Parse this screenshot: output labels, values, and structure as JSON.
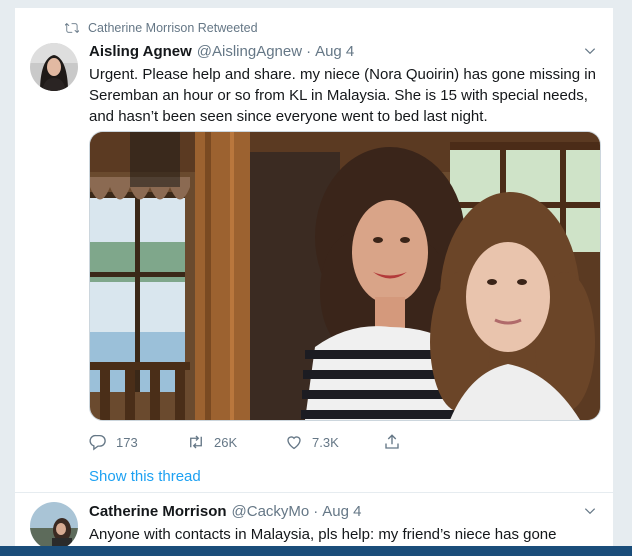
{
  "timeline": {
    "tweet1": {
      "retweet_context": "Catherine Morrison Retweeted",
      "author_name": "Aisling Agnew",
      "author_handle": "@AislingAgnew",
      "separator": "·",
      "date": "Aug 4",
      "text": "Urgent. Please help and share. my niece (Nora Quoirin) has gone missing in Seremban an hour or so from KL in Malaysia. She is 15 with special needs, and hasn’t been seen since everyone went to bed last night.",
      "actions": {
        "replies": "173",
        "retweets": "26K",
        "likes": "7.3K"
      },
      "show_thread": "Show this thread"
    },
    "tweet2": {
      "author_name": "Catherine Morrison",
      "author_handle": "@CackyMo",
      "separator": "·",
      "date": "Aug 4",
      "text": "Anyone with contacts in Malaysia, pls help: my friend’s niece has gone"
    }
  },
  "icons": {
    "retweet_context": "retweet-icon",
    "caret": "chevron-down-icon",
    "reply": "reply-icon",
    "retweet": "retweet-icon",
    "like": "heart-icon",
    "share": "share-icon"
  },
  "colors": {
    "accent": "#1da1f2",
    "secondary_text": "#657786",
    "primary_text": "#14171a",
    "background": "#e6ecf0",
    "bottom_bar": "#1a4d7a"
  }
}
